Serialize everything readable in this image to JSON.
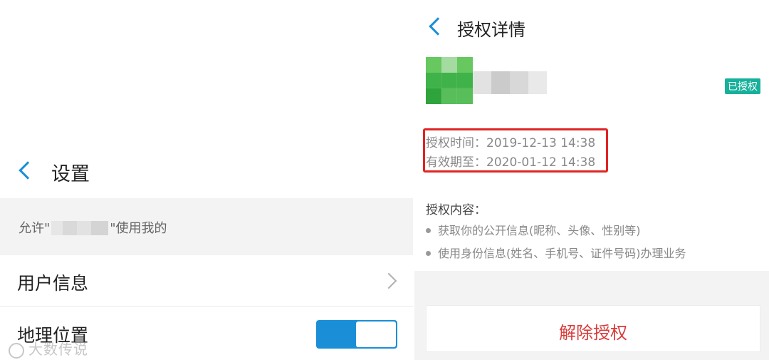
{
  "settings_screen": {
    "title": "设置",
    "permission_prefix": "允许\"",
    "permission_suffix": "\"使用我的",
    "items": [
      {
        "label": "用户信息",
        "type": "link"
      },
      {
        "label": "地理位置",
        "type": "toggle",
        "enabled": true
      }
    ]
  },
  "watermark": {
    "text": "大数传说"
  },
  "auth_screen": {
    "title": "授权详情",
    "status_badge": "已授权",
    "auth_time_label": "授权时间：",
    "auth_time_value": "2019-12-13 14:38",
    "valid_until_label": "有效期至：",
    "valid_until_value": "2020-01-12 14:38",
    "content_title": "授权内容：",
    "content_items": [
      "获取你的公开信息(昵称、头像、性别等)",
      "使用身份信息(姓名、手机号、证件号码)办理业务"
    ],
    "revoke_button": "解除授权"
  },
  "colors": {
    "accent": "#1a8fd8",
    "badge": "#17b19b",
    "highlight_box": "#e02424",
    "revoke_text": "#d83c3c"
  },
  "icons": {
    "back": "chevron-left-icon",
    "row_arrow": "chevron-right-icon"
  }
}
